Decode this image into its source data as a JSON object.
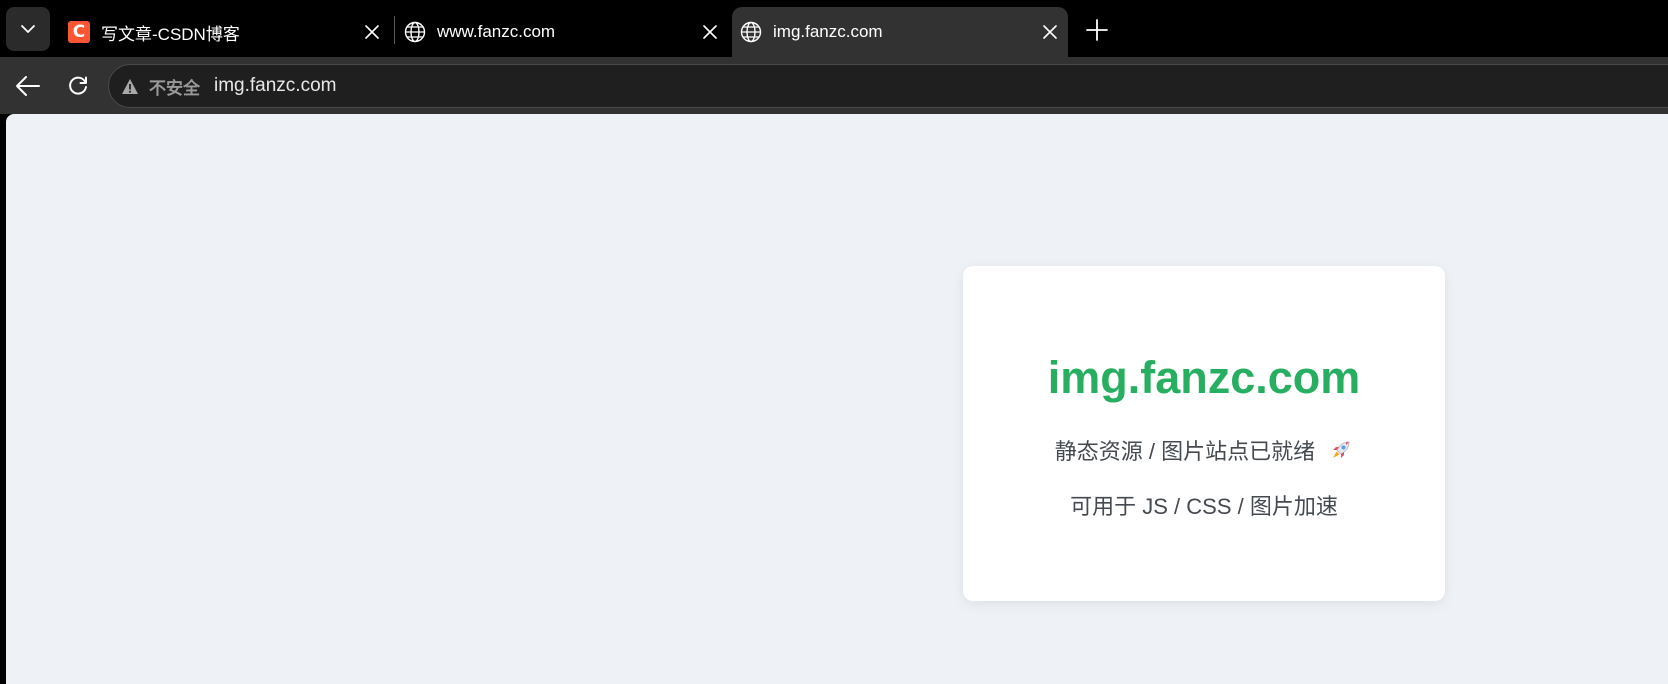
{
  "browser": {
    "tabs": [
      {
        "title": "写文章-CSDN博客",
        "favicon": "csdn-icon",
        "favicon_text": "C",
        "favicon_color": "#fc5531",
        "active": false
      },
      {
        "title": "www.fanzc.com",
        "favicon": "globe-icon",
        "active": false
      },
      {
        "title": "img.fanzc.com",
        "favicon": "globe-icon",
        "active": true
      }
    ],
    "address_bar": {
      "security_label": "不安全",
      "url": "img.fanzc.com"
    }
  },
  "page": {
    "card": {
      "title": "img.fanzc.com",
      "line1": "静态资源 / 图片站点已就绪",
      "line2": "可用于 JS / CSS / 图片加速",
      "title_color": "#27ae60",
      "icon": "rocket-icon"
    }
  },
  "colors": {
    "page_background": "#eef1f5",
    "card_background": "#ffffff",
    "tabbar_background": "#000000",
    "toolbar_background": "#323232"
  }
}
